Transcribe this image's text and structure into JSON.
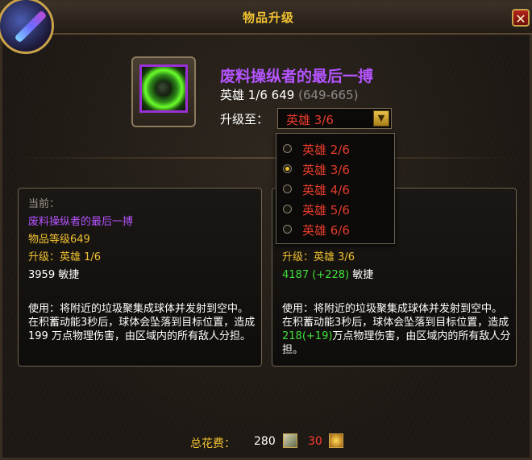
{
  "window": {
    "title": "物品升级",
    "close_label": "✕"
  },
  "item": {
    "name": "废料操纵者的最后一搏",
    "rank_text": "英雄 1/6 649",
    "range_text": "(649-665)"
  },
  "upgrade_to": {
    "label": "升级至：",
    "selected": "英雄 3/6",
    "options": [
      {
        "label": "英雄 2/6",
        "selected": false
      },
      {
        "label": "英雄 3/6",
        "selected": true
      },
      {
        "label": "英雄 4/6",
        "selected": false
      },
      {
        "label": "英雄 5/6",
        "selected": false
      },
      {
        "label": "英雄 6/6",
        "selected": false
      }
    ]
  },
  "current": {
    "heading": "当前：",
    "name": "废料操纵者的最后一搏",
    "item_level": "物品等级649",
    "upgrade": "升级：英雄 1/6",
    "stat": "3959 敏捷",
    "description": "使用：将附近的垃圾聚集成球体并发射到空中。在积蓄动能3秒后，球体会坠落到目标位置，造成199 万点物理伤害，由区域内的所有敌人分担。"
  },
  "upgraded": {
    "upgrade": "升级：英雄 3/6",
    "stat_value": "4187",
    "stat_delta": "(+228)",
    "stat_name": "敏捷",
    "description_part1": "使用：将附近的垃圾聚集成球体并发射到空中。在积蓄动能3秒后，球体会坠落到目标位置，造成",
    "damage_value": "218",
    "damage_delta": "(+19)",
    "description_part2": "万点物理伤害，由区域内的所有敌人分担。"
  },
  "cost": {
    "label": "总花费：",
    "amount1": "280",
    "amount2": "30"
  },
  "colors": {
    "title_gold": "#f1c232",
    "epic_purple": "#b454ff",
    "rank_red": "#e33b2c",
    "upgrade_green": "#3fe03a"
  },
  "icons": [
    "portrait-icon",
    "item-icon",
    "close-icon",
    "dropdown-arrow-icon",
    "crest-currency-icon",
    "flightstone-currency-icon"
  ]
}
